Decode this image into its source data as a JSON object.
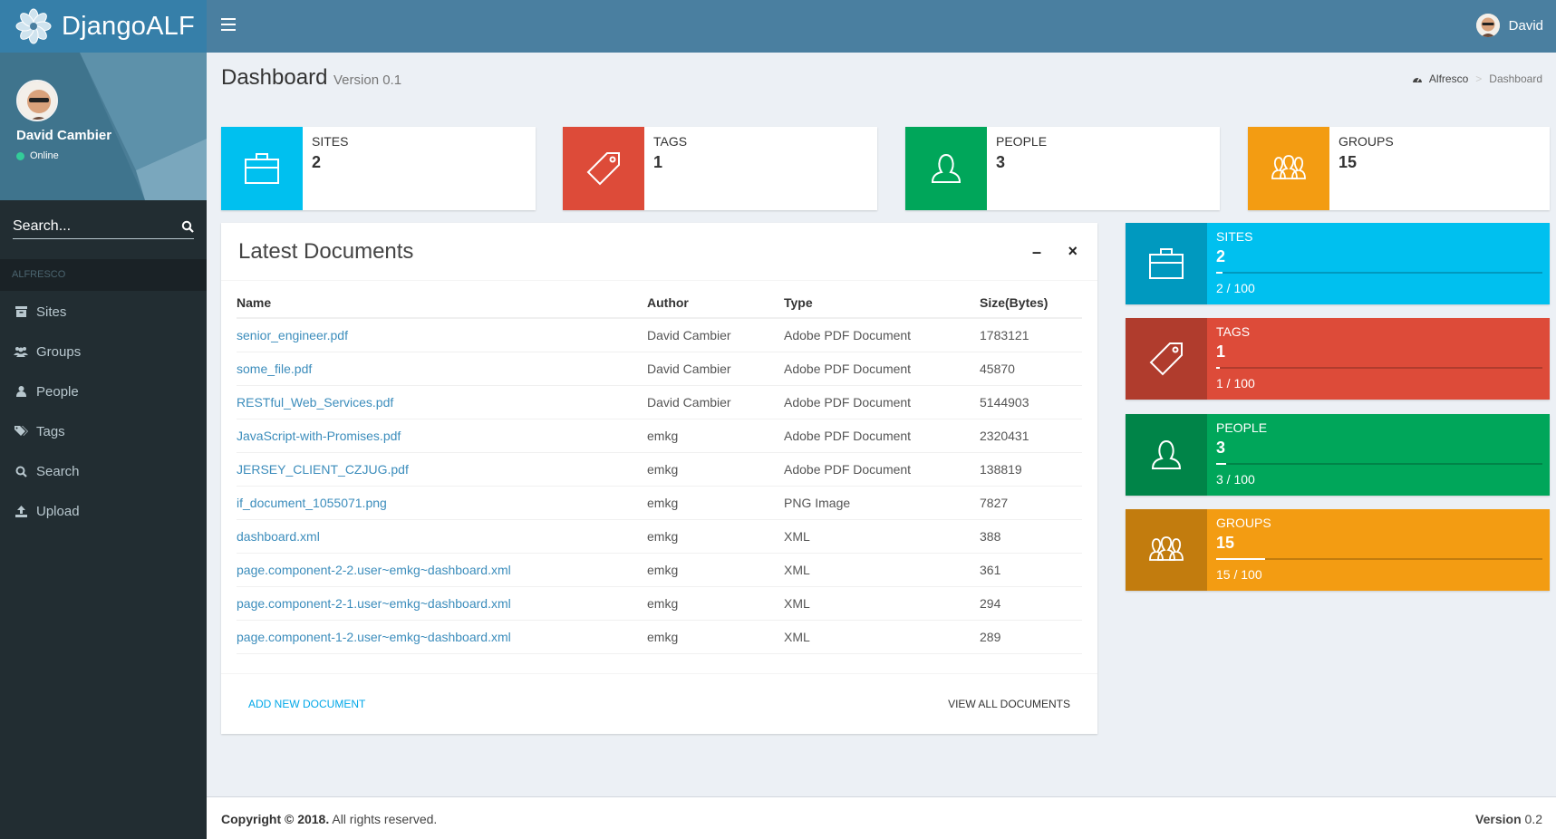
{
  "app": {
    "name": "DjangoALF"
  },
  "sidebar": {
    "user_name": "David Cambier",
    "status": "Online",
    "search_placeholder": "Search...",
    "section": "ALFRESCO",
    "items": [
      {
        "label": "Sites",
        "icon": "archive-icon"
      },
      {
        "label": "Groups",
        "icon": "users-icon"
      },
      {
        "label": "People",
        "icon": "user-icon"
      },
      {
        "label": "Tags",
        "icon": "tags-icon"
      },
      {
        "label": "Search",
        "icon": "search-icon"
      },
      {
        "label": "Upload",
        "icon": "upload-icon"
      }
    ]
  },
  "header": {
    "user": "David"
  },
  "page": {
    "title": "Dashboard",
    "version": "Version 0.1",
    "breadcrumb": [
      "Alfresco",
      "Dashboard"
    ]
  },
  "info_boxes": [
    {
      "label": "SITES",
      "value": "2",
      "color": "#00c0ef",
      "icon": "briefcase-icon"
    },
    {
      "label": "TAGS",
      "value": "1",
      "color": "#dd4b39",
      "icon": "tag-icon"
    },
    {
      "label": "PEOPLE",
      "value": "3",
      "color": "#00a65a",
      "icon": "person-icon"
    },
    {
      "label": "GROUPS",
      "value": "15",
      "color": "#f39c12",
      "icon": "group-icon"
    }
  ],
  "documents": {
    "title": "Latest Documents",
    "columns": [
      "Name",
      "Author",
      "Type",
      "Size(Bytes)"
    ],
    "rows": [
      [
        "senior_engineer.pdf",
        "David Cambier",
        "Adobe PDF Document",
        "1783121"
      ],
      [
        "some_file.pdf",
        "David Cambier",
        "Adobe PDF Document",
        "45870"
      ],
      [
        "RESTful_Web_Services.pdf",
        "David Cambier",
        "Adobe PDF Document",
        "5144903"
      ],
      [
        "JavaScript-with-Promises.pdf",
        "emkg",
        "Adobe PDF Document",
        "2320431"
      ],
      [
        "JERSEY_CLIENT_CZJUG.pdf",
        "emkg",
        "Adobe PDF Document",
        "138819"
      ],
      [
        "if_document_1055071.png",
        "emkg",
        "PNG Image",
        "7827"
      ],
      [
        "dashboard.xml",
        "emkg",
        "XML",
        "388"
      ],
      [
        "page.component-2-2.user~emkg~dashboard.xml",
        "emkg",
        "XML",
        "361"
      ],
      [
        "page.component-2-1.user~emkg~dashboard.xml",
        "emkg",
        "XML",
        "294"
      ],
      [
        "page.component-1-2.user~emkg~dashboard.xml",
        "emkg",
        "XML",
        "289"
      ]
    ],
    "add_label": "ADD NEW DOCUMENT",
    "view_all_label": "VIEW ALL DOCUMENTS"
  },
  "progress_boxes": [
    {
      "label": "SITES",
      "value": "2",
      "desc": "2 / 100",
      "progress": 0.02,
      "color": "#00c0ef",
      "icon": "briefcase-icon"
    },
    {
      "label": "TAGS",
      "value": "1",
      "desc": "1 / 100",
      "progress": 0.01,
      "color": "#dd4b39",
      "icon": "tag-icon"
    },
    {
      "label": "PEOPLE",
      "value": "3",
      "desc": "3 / 100",
      "progress": 0.03,
      "color": "#00a65a",
      "icon": "person-icon"
    },
    {
      "label": "GROUPS",
      "value": "15",
      "desc": "15 / 100",
      "progress": 0.15,
      "color": "#f39c12",
      "icon": "group-icon"
    }
  ],
  "footer": {
    "copyright": "Copyright © 2018.",
    "rights": " All rights reserved.",
    "version_label": "Version",
    "version_value": " 0.2"
  }
}
